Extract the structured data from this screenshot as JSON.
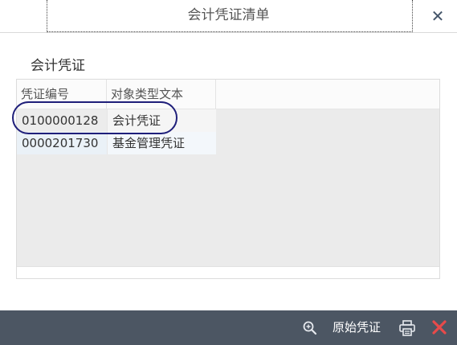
{
  "dialog": {
    "title": "会计凭证清单",
    "close_icon": "close-icon"
  },
  "section": {
    "title": "会计凭证"
  },
  "table": {
    "columns": [
      "凭证编号",
      "对象类型文本"
    ],
    "rows": [
      [
        "0100000128",
        "会计凭证"
      ],
      [
        "0000201730",
        "基金管理凭证"
      ]
    ]
  },
  "toolbar": {
    "search_icon": "zoom-icon",
    "original_voucher_label": "原始凭证",
    "print_icon": "print-icon",
    "exit_icon": "close-icon"
  },
  "colors": {
    "toolbar_bg": "#4c5663",
    "highlight_oval": "#1f1f7a",
    "exit_red": "#e84a4a"
  }
}
